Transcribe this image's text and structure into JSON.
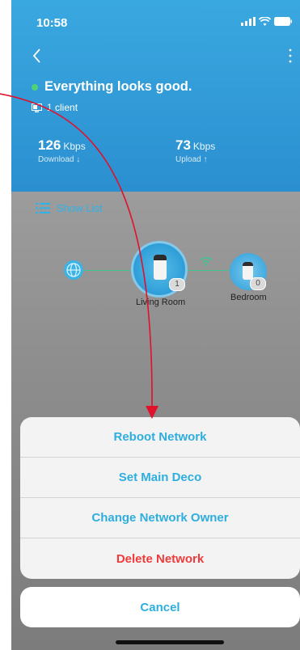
{
  "statusbar": {
    "time": "10:58"
  },
  "header": {
    "status_text": "Everything looks good.",
    "clients": "1 client",
    "download": {
      "value": "126",
      "unit": "Kbps",
      "label": "Download ↓"
    },
    "upload": {
      "value": "73",
      "unit": "Kbps",
      "label": "Upload ↑"
    }
  },
  "map": {
    "show_list": "Show List",
    "nodes": [
      {
        "name": "Living Room",
        "clients": "1"
      },
      {
        "name": "Bedroom",
        "clients": "0"
      }
    ]
  },
  "action_sheet": {
    "items": [
      "Reboot Network",
      "Set Main Deco",
      "Change Network Owner",
      "Delete Network"
    ],
    "cancel": "Cancel"
  },
  "colors": {
    "accent": "#2eaedf",
    "danger": "#ef3b3b",
    "header": "#2b8fd0",
    "status_ok": "#4ed277"
  }
}
